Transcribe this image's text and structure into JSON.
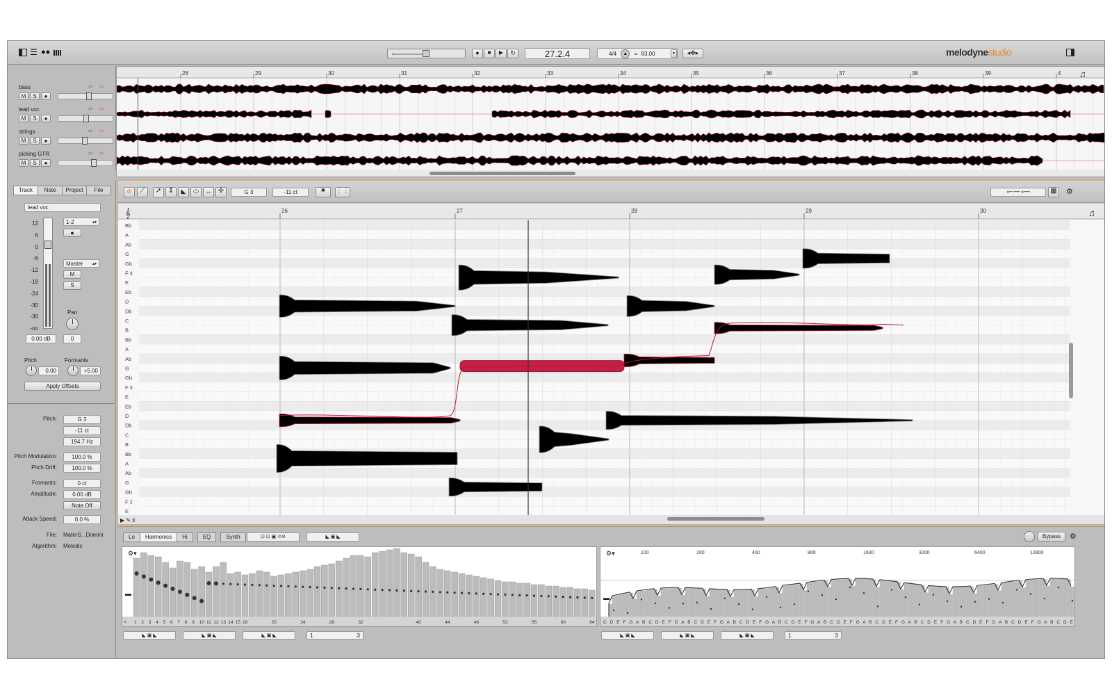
{
  "app": {
    "brand": "melodyne",
    "edition": "studio"
  },
  "transport": {
    "position": "27.2.4",
    "time_signature": "4/4",
    "tempo_symbol": "=",
    "tempo": "83.00"
  },
  "arrange": {
    "bars": [
      "28",
      "29",
      "30",
      "31",
      "32",
      "33",
      "34",
      "35",
      "36",
      "37",
      "38",
      "39",
      "4"
    ],
    "tracks": [
      {
        "name": "bass",
        "mute": "M",
        "solo": "S",
        "level": 0.52
      },
      {
        "name": "lead voc",
        "mute": "M",
        "solo": "S",
        "level": 0.48
      },
      {
        "name": "strings",
        "mute": "M",
        "solo": "S",
        "level": 0.45
      },
      {
        "name": "picking GTR",
        "mute": "M",
        "solo": "S",
        "level": 0.62
      }
    ]
  },
  "inspector": {
    "tabs": [
      "Track",
      "Note",
      "Project",
      "File"
    ],
    "track_name": "lead voc",
    "meter_scale": [
      "12",
      "6",
      "0",
      "-6",
      "-12",
      "-18",
      "-24",
      "-30",
      "-36",
      "-oo"
    ],
    "input": "1-2",
    "output": "Master",
    "mute": "M",
    "solo": "S",
    "pan_label": "Pan",
    "volume": "0.00 dB",
    "pan": "0",
    "pitch_label": "Pitch",
    "formants_label": "Formants",
    "pitch_value": "0.00",
    "formants_value": "+5.00",
    "apply_offsets": "Apply Offsets"
  },
  "note_props": {
    "pitch_label": "Pitch:",
    "pitch_note": "G 3",
    "pitch_cents": "-11 ct",
    "pitch_hz": "194.7 Hz",
    "pitch_mod_label": "Pitch Modulation:",
    "pitch_mod": "100.0 %",
    "pitch_drift_label": "Pitch Drift:",
    "pitch_drift": "100.0 %",
    "formants_label": "Formants:",
    "formants": "0 ct",
    "amplitude_label": "Amplitude:",
    "amplitude": "0.00 dB",
    "note_off": "Note Off",
    "attack_label": "Attack Speed:",
    "attack": "0.0 %",
    "file_label": "File:",
    "file": "MaterS...Domini",
    "algorithm_label": "Algorithm:",
    "algorithm": "Melodic"
  },
  "editor": {
    "pitch_field": "G 3",
    "cents_field": "-11 ct",
    "bars": [
      "26",
      "27",
      "28",
      "29",
      "30"
    ],
    "pitch_labels": [
      "Bb",
      "A",
      "Ab",
      "G",
      "Gb",
      "F 4",
      "E",
      "Eb",
      "D",
      "Db",
      "C",
      "B",
      "Bb",
      "A",
      "Ab",
      "G",
      "Gb",
      "F 3",
      "E",
      "Eb",
      "D",
      "Db",
      "C",
      "B",
      "Bb",
      "A",
      "Ab",
      "G",
      "Gb",
      "F 2",
      "E"
    ]
  },
  "sound_editor": {
    "tabs": [
      "Lo",
      "Harmonics",
      "Hi",
      "EQ",
      "Synth"
    ],
    "bypass": "Bypass",
    "harmonic_numbers": [
      "1",
      "2",
      "3",
      "4",
      "5",
      "6",
      "7",
      "8",
      "9",
      "10",
      "11",
      "12",
      "13",
      "14",
      "15",
      "16",
      "20",
      "24",
      "28",
      "32",
      "40",
      "44",
      "48",
      "52",
      "56",
      "60",
      "64"
    ],
    "freq_labels": [
      "100",
      "200",
      "400",
      "800",
      "1600",
      "3200",
      "6400",
      "12800"
    ],
    "note_letters": "C D E F G A B C D E F G A B C D E F G A B C D E F G A B C D E F G A B C D E F G A B C D E F G A B C D E F G A B C D E F G A B C D E F G A B C D E",
    "page_num_1": "1",
    "page_num_3": "3"
  },
  "colors": {
    "accent": "#e8872a",
    "blob": "#c41f45",
    "panel": "#bdbdbd"
  }
}
